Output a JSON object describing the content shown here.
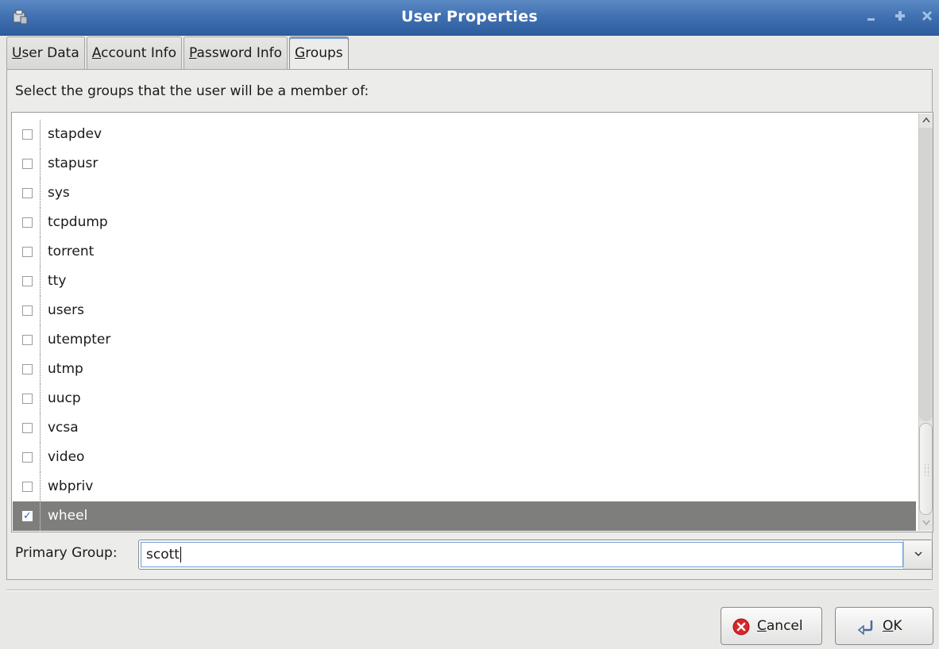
{
  "window": {
    "title": "User Properties",
    "controls": [
      "minimize",
      "maximize",
      "close"
    ]
  },
  "tabs": [
    {
      "mnemonic": "U",
      "rest": "ser Data",
      "active": false
    },
    {
      "mnemonic": "A",
      "rest": "ccount Info",
      "active": false
    },
    {
      "mnemonic": "P",
      "rest": "assword Info",
      "active": false
    },
    {
      "mnemonic": "G",
      "rest": "roups",
      "active": true
    }
  ],
  "groups_panel": {
    "instruction": "Select the groups that the user will be a member of:",
    "groups": [
      {
        "name": "stapdev",
        "checked": false
      },
      {
        "name": "stapusr",
        "checked": false
      },
      {
        "name": "sys",
        "checked": false
      },
      {
        "name": "tcpdump",
        "checked": false
      },
      {
        "name": "torrent",
        "checked": false
      },
      {
        "name": "tty",
        "checked": false
      },
      {
        "name": "users",
        "checked": false
      },
      {
        "name": "utempter",
        "checked": false
      },
      {
        "name": "utmp",
        "checked": false
      },
      {
        "name": "uucp",
        "checked": false
      },
      {
        "name": "vcsa",
        "checked": false
      },
      {
        "name": "video",
        "checked": false
      },
      {
        "name": "wbpriv",
        "checked": false
      },
      {
        "name": "wheel",
        "checked": true,
        "selected": true
      }
    ],
    "primary_group_label": "Primary Group:",
    "primary_group_value": "scott"
  },
  "buttons": {
    "cancel": {
      "mnemonic": "C",
      "rest": "ancel"
    },
    "ok": {
      "mnemonic": "O",
      "rest": "K"
    }
  },
  "colors": {
    "titlebar": "#3f6fb0",
    "selection": "#7e7e7c",
    "check_accent": "#2a5ec9"
  }
}
